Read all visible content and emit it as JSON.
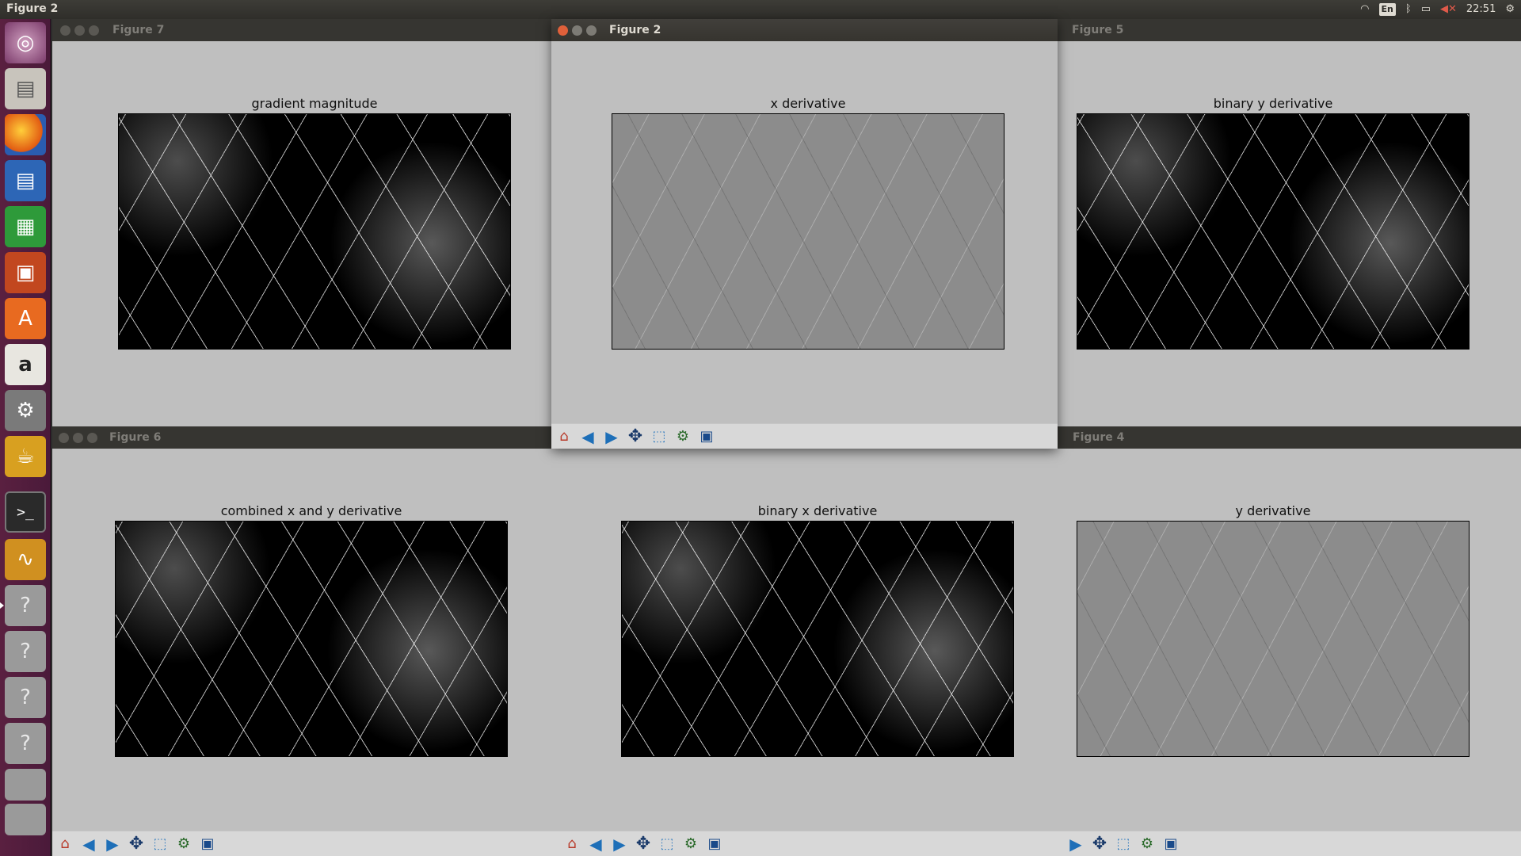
{
  "top_panel": {
    "app_title": "Figure 2",
    "keyboard_layout": "En",
    "clock": "22:51",
    "tray_icons": [
      "wifi-icon",
      "keyboard-layout-icon",
      "bluetooth-icon",
      "battery-icon",
      "volume-muted-icon",
      "settings-gear-icon"
    ]
  },
  "launcher": {
    "items": [
      "ubuntu-dash",
      "files",
      "firefox",
      "libreoffice-writer",
      "libreoffice-calc",
      "libreoffice-impress",
      "software-center",
      "amazon",
      "system-settings",
      "teapot-app",
      "terminal",
      "waveform-app",
      "unknown-app",
      "unknown-app",
      "unknown-app",
      "unknown-app"
    ],
    "amazon_glyph": "a",
    "unknown_glyph": "?"
  },
  "windows": [
    {
      "id": "fig7",
      "title": "Figure 7",
      "plot_title": "gradient magnitude",
      "image": "binary",
      "state": "inactive"
    },
    {
      "id": "fig2",
      "title": "Figure 2",
      "plot_title": "x derivative",
      "image": "grayscale",
      "state": "active"
    },
    {
      "id": "fig5",
      "title": "Figure 5",
      "plot_title": "binary y derivative",
      "image": "binary",
      "state": "inactive"
    },
    {
      "id": "fig6",
      "title": "Figure 6",
      "plot_title": "combined x and y derivative",
      "image": "binary",
      "state": "inactive"
    },
    {
      "id": "fig3",
      "title": "",
      "plot_title": "binary x derivative",
      "image": "binary",
      "state": "inactive"
    },
    {
      "id": "fig4",
      "title": "Figure 4",
      "plot_title": "y derivative",
      "image": "grayscale",
      "state": "inactive"
    }
  ],
  "toolbar_tools": [
    "home-icon",
    "back-icon",
    "forward-icon",
    "pan-icon",
    "zoom-icon",
    "configure-subplots-icon",
    "save-icon"
  ],
  "colors": {
    "figure_bg": "#bfbfbf",
    "toolbar_bg": "#d8d8d8",
    "launcher_bg": "#5a2040",
    "close_button": "#e0603a"
  }
}
